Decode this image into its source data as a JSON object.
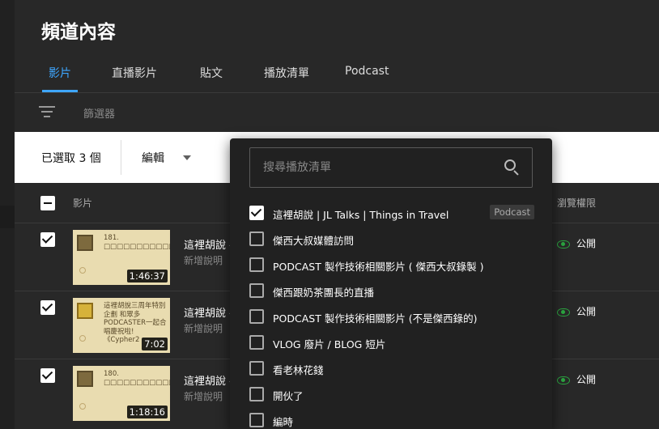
{
  "page": {
    "title": "頻道內容"
  },
  "tabs": [
    {
      "label": "影片"
    },
    {
      "label": "直播影片"
    },
    {
      "label": "貼文"
    },
    {
      "label": "播放清單"
    },
    {
      "label": "Podcast"
    }
  ],
  "filter": {
    "label": "篩選器"
  },
  "selection": {
    "count_label": "已選取 3 個",
    "edit_label": "編輯"
  },
  "table_header": {
    "video": "影片",
    "visibility": "瀏覽權限"
  },
  "rows": [
    {
      "thumb_text": "181. □□□□□□□□□□□□□□□□□□□□□□□□□□□□□□□",
      "duration": "1:46:37",
      "title": "這裡胡說 -",
      "desc": "新增說明",
      "visibility": "公開",
      "checked": true
    },
    {
      "thumb_text": "這裡胡說三周年特別企劃 和眾多PODCASTER一起合唱慶祝啦!《Cypher2",
      "duration": "7:02",
      "title": "這裡胡說 -",
      "desc": "新增說明",
      "visibility": "公開",
      "checked": true
    },
    {
      "thumb_text": "180. □□□□□□□□□□□□□□□□□□□□□□□□□□□□□□□",
      "duration": "1:18:16",
      "title": "這裡胡說 -",
      "desc": "新增說明",
      "visibility": "公開",
      "checked": true
    }
  ],
  "playlist_dropdown": {
    "search_placeholder": "搜尋播放清單",
    "items": [
      {
        "label": "這裡胡說 | JL Talks | Things in Travel",
        "checked": true,
        "badge": "Podcast"
      },
      {
        "label": "傑西大叔媒體訪問",
        "checked": false
      },
      {
        "label": "PODCAST 製作技術相關影片 ( 傑西大叔錄製 )",
        "checked": false
      },
      {
        "label": "傑西跟奶茶團長的直播",
        "checked": false
      },
      {
        "label": "PODCAST 製作技術相關影片 (不是傑西錄的)",
        "checked": false
      },
      {
        "label": "VLOG 廢片 / BLOG 短片",
        "checked": false
      },
      {
        "label": "看老林花錢",
        "checked": false
      },
      {
        "label": "開伙了",
        "checked": false
      },
      {
        "label": "編時",
        "checked": false
      }
    ]
  },
  "colors": {
    "accent": "#3ea6ff",
    "public_green": "#2ba640"
  }
}
